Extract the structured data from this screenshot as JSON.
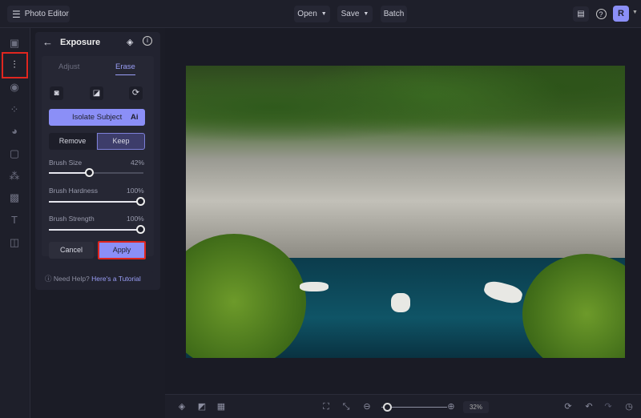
{
  "header": {
    "menu_icon": "hamburger-icon",
    "app_title": "Photo Editor",
    "open": "Open",
    "save": "Save",
    "batch": "Batch",
    "avatar": "R"
  },
  "panel": {
    "title": "Exposure",
    "tabs": [
      "Adjust",
      "Erase"
    ],
    "active_tab": "Erase",
    "isolate": "Isolate Subject",
    "ai_badge": "Ai",
    "remove": "Remove",
    "keep": "Keep",
    "active_mode": "Keep",
    "sliders": [
      {
        "label": "Brush Size",
        "value": "42%",
        "level": 42
      },
      {
        "label": "Brush Hardness",
        "value": "100%",
        "level": 100
      },
      {
        "label": "Brush Strength",
        "value": "100%",
        "level": 100
      }
    ],
    "cancel": "Cancel",
    "apply": "Apply",
    "help_q": "Need Help?",
    "help_link": "Here's a Tutorial"
  },
  "bottom": {
    "zoom": "32%",
    "zoom_level": 32
  },
  "colors": {
    "accent": "#8b8ff7",
    "highlight": "#e0261f"
  }
}
